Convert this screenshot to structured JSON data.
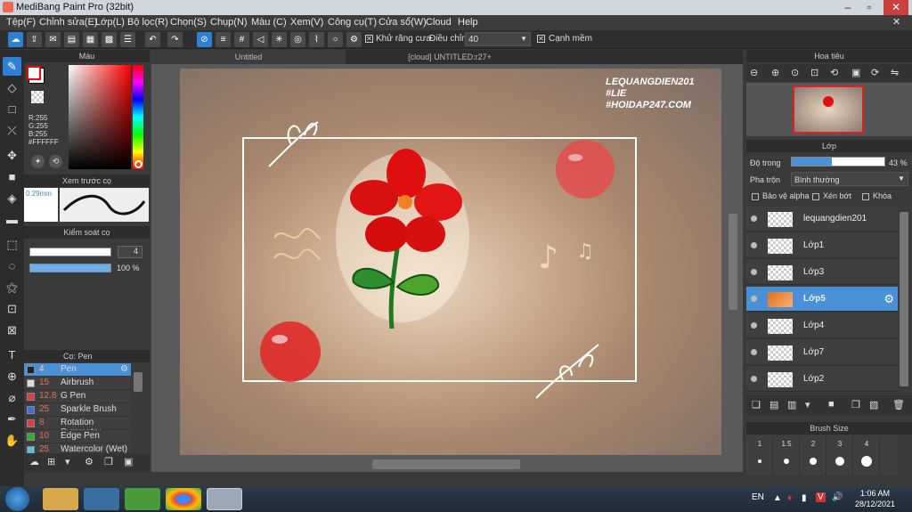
{
  "window": {
    "title": "MediBang Paint Pro (32bit)"
  },
  "menu": [
    "Tệp(F)",
    "Chỉnh sửa(E)",
    "Lớp(L)",
    "Bộ lọc(R)",
    "Chọn(S)",
    "Chụp(N)",
    "Màu (C)",
    "Xem(V)",
    "Công cụ(T)",
    "Cửa sổ(W)",
    "Cloud",
    "Help"
  ],
  "toolbar": {
    "antialias_label": "Khử răng cưa",
    "adjust_label": "Điều chỉnh",
    "adjust_value": "40",
    "sharp_label": "Cạnh mềm"
  },
  "color_panel": {
    "title": "Màu",
    "r": "R:255",
    "g": "G:255",
    "b": "B:255",
    "hex": "#FFFFFF",
    "accent": "#ff0000"
  },
  "brush_preview": {
    "title": "Xem trước cọ",
    "size": "0.29mm"
  },
  "brush_control": {
    "title": "Kiểm soát cọ",
    "size_value": "4",
    "opacity_value": "100 %"
  },
  "brush_list": {
    "title": "Cọ: Pen",
    "items": [
      {
        "size": "4",
        "name": "Pen",
        "color": "#222222"
      },
      {
        "size": "15",
        "name": "Airbrush",
        "color": "#dddddd"
      },
      {
        "size": "12.8",
        "name": "G Pen",
        "color": "#e23b3b"
      },
      {
        "size": "25",
        "name": "Sparkle Brush",
        "color": "#3a6fd8"
      },
      {
        "size": "8",
        "name": "Rotation Symmetry",
        "color": "#e23b3b"
      },
      {
        "size": "10",
        "name": "Edge Pen",
        "color": "#2fae2f"
      },
      {
        "size": "25",
        "name": "Watercolor (Wet)",
        "color": "#59c0e0"
      }
    ]
  },
  "tabs": {
    "tab1": "Untitled",
    "tab2": "[cloud] UNTITLED:r27+"
  },
  "canvas_text": {
    "line1": "LEQUANGDIEN201",
    "line2": "#LIE",
    "line3": "#HOIDAP247.COM"
  },
  "navigator": {
    "title": "Hoa tiêu"
  },
  "layer_panel": {
    "title": "Lớp",
    "opacity_label": "Độ trong",
    "opacity_value": "43 %",
    "opacity_fraction": 0.43,
    "blend_label": "Pha trộn",
    "blend_value": "Bình thường",
    "protect_alpha": "Bảo vệ alpha",
    "clip": "Xén bớt",
    "lock": "Khóa",
    "layers": [
      "lequangdien201",
      "Lớp1",
      "Lớp3",
      "Lớp5",
      "Lớp4",
      "Lớp7",
      "Lớp2"
    ]
  },
  "brush_size": {
    "title": "Brush Size",
    "sizes": [
      "1",
      "1.5",
      "2",
      "3",
      "4"
    ]
  },
  "taskbar": {
    "lang": "EN",
    "time": "1:06 AM",
    "date": "28/12/2021"
  }
}
